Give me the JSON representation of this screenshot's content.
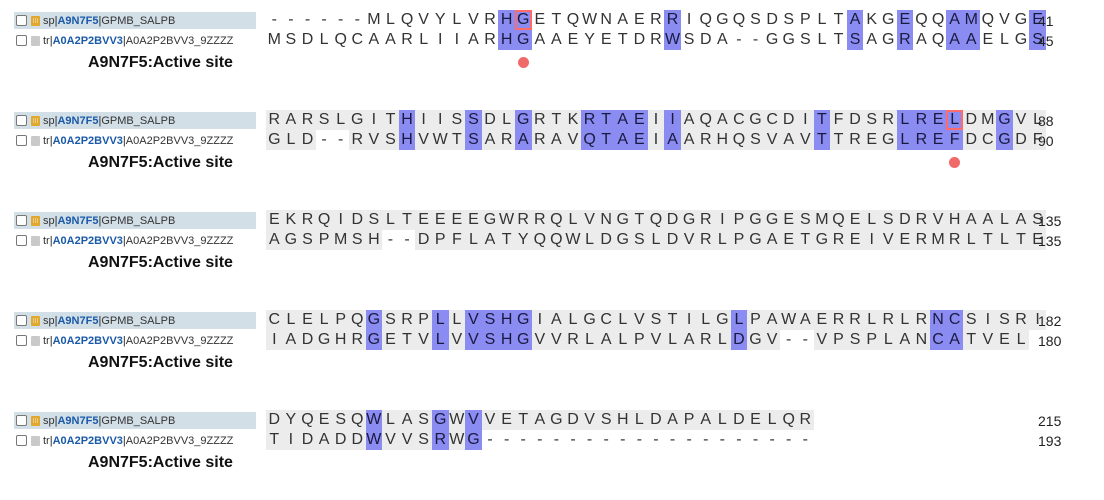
{
  "sequences": {
    "query": {
      "db": "sp",
      "accession": "A9N7F5",
      "name": "GPMB_SALPB",
      "icon": "swissprot-icon"
    },
    "subject": {
      "db": "tr",
      "accession": "A0A2P2BVV3",
      "name": "A0A2P2BVV3_9ZZZZ",
      "icon": "trembl-icon"
    }
  },
  "site_label": "A9N7F5:Active site",
  "colors": {
    "conserved": "#8a8cf2",
    "similar": "#ececec",
    "active_site": "#f06a6a",
    "label_bar": "#d3dfe7"
  },
  "blocks": [
    {
      "seq1": "------MLQVYLVRHGETQWNAERRIQGQSDSPLTAKGEQQAMQVGE",
      "seq2": "MSDLQCAARLIIARHGAAEYETDRWSDA--GGSLTSAGRAQAAELGS",
      "mask": "000000000000002200000000200000000002002002200022",
      "active": [
        15
      ],
      "end1": "41",
      "end2": "45"
    },
    {
      "seq1": "RARSLGITHIISSDLGRTKRTAEIIAQACGCDITFDSRLRELDMGVL",
      "seq2": "GLD--RVSHVWTSARARAVQTAEIAARHQSVAVTTREGLREFDCGDF",
      "mask": "11111111211121121112222121111111121111222211211",
      "active": [
        41
      ],
      "end1": "88",
      "end2": "90"
    },
    {
      "seq1": "EKRQIDSLTEEEEGWRRQLVNGTQDGRIPGGESMQELSDRVHAALAS",
      "seq2": "AGSPMSH--DPFLATYQQWLDGSLDVRLPGAETGREIVERMRLTLTE",
      "mask": "11111111111111111111111111111111111111111111111",
      "active": [],
      "end1": "135",
      "end2": "135"
    },
    {
      "seq1": "CLELPQGSRPLLVSHGIALGCLVSTILGLPAWAERRLRLRNCSISRI",
      "seq2": "IADGHRGETVLVVSHGVVRLALPVLARLDGV--VPSPLANCATVEL",
      "mask": "11111121112122221111111111112111111111112211111",
      "active": [],
      "end1": "182",
      "end2": "180"
    },
    {
      "seq1": "DYQESQWLASGWVVETAGDVSHLDAPALDELQR",
      "seq2": "TIDADDWVVSRWG--------------------",
      "mask": "111111211121211111111111111111111",
      "active": [],
      "end1": "215",
      "end2": "193"
    }
  ]
}
